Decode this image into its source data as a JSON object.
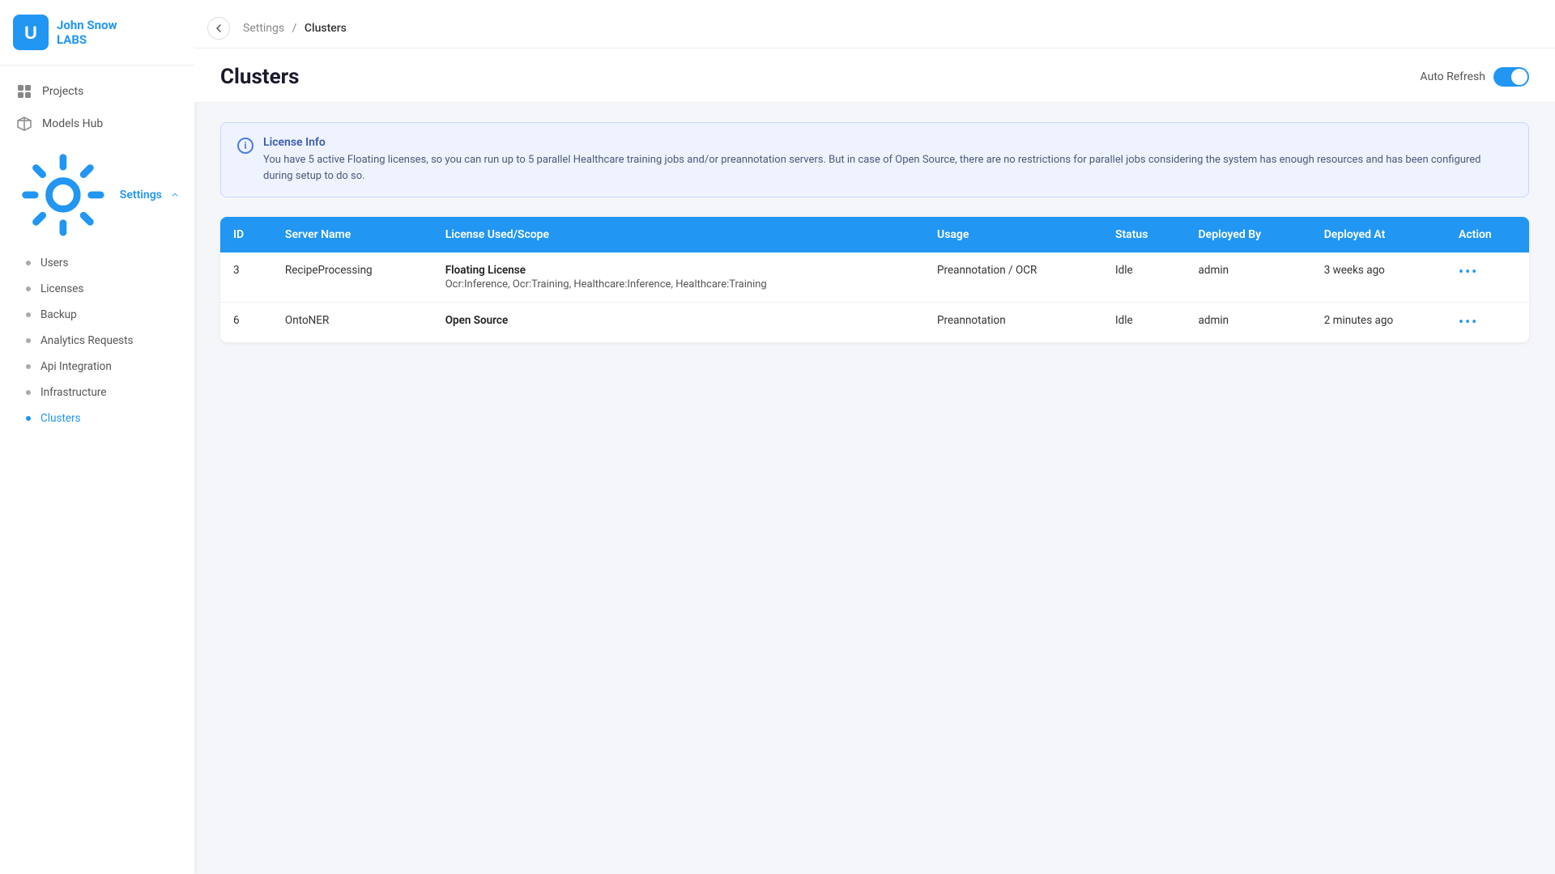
{
  "brand": {
    "name_line1": "John Snow",
    "name_line2": "LABS"
  },
  "sidebar": {
    "nav_items": [
      {
        "id": "projects",
        "label": "Projects",
        "icon": "grid"
      },
      {
        "id": "models_hub",
        "label": "Models Hub",
        "icon": "cube"
      }
    ],
    "settings_group": {
      "label": "Settings",
      "icon": "gear",
      "sub_items": [
        {
          "id": "users",
          "label": "Users",
          "active": false
        },
        {
          "id": "licenses",
          "label": "Licenses",
          "active": false
        },
        {
          "id": "backup",
          "label": "Backup",
          "active": false
        },
        {
          "id": "analytics_requests",
          "label": "Analytics Requests",
          "active": false
        },
        {
          "id": "api_integration",
          "label": "Api Integration",
          "active": false
        },
        {
          "id": "infrastructure",
          "label": "Infrastructure",
          "active": false
        },
        {
          "id": "clusters",
          "label": "Clusters",
          "active": true
        }
      ]
    }
  },
  "breadcrumb": {
    "parent": "Settings",
    "separator": "/",
    "current": "Clusters"
  },
  "page": {
    "title": "Clusters",
    "auto_refresh_label": "Auto Refresh"
  },
  "license_info": {
    "title": "License Info",
    "body": "You have 5 active Floating licenses, so you can run up to 5 parallel Healthcare training jobs and/or preannotation servers. But in case of Open Source, there are no restrictions for parallel jobs considering the system has enough resources and has been configured during setup to do so."
  },
  "table": {
    "headers": [
      "ID",
      "Server Name",
      "License Used/Scope",
      "Usage",
      "Status",
      "Deployed By",
      "Deployed At",
      "Action"
    ],
    "rows": [
      {
        "id": "3",
        "server_name": "RecipeProcessing",
        "license_type": "Floating License",
        "license_scope": "Ocr:Inference, Ocr:Training, Healthcare:Inference, Healthcare:Training",
        "usage": "Preannotation / OCR",
        "status": "Idle",
        "deployed_by": "admin",
        "deployed_at": "3 weeks ago"
      },
      {
        "id": "6",
        "server_name": "OntoNER",
        "license_type": "Open Source",
        "license_scope": "",
        "usage": "Preannotation",
        "status": "Idle",
        "deployed_by": "admin",
        "deployed_at": "2 minutes ago"
      }
    ]
  }
}
